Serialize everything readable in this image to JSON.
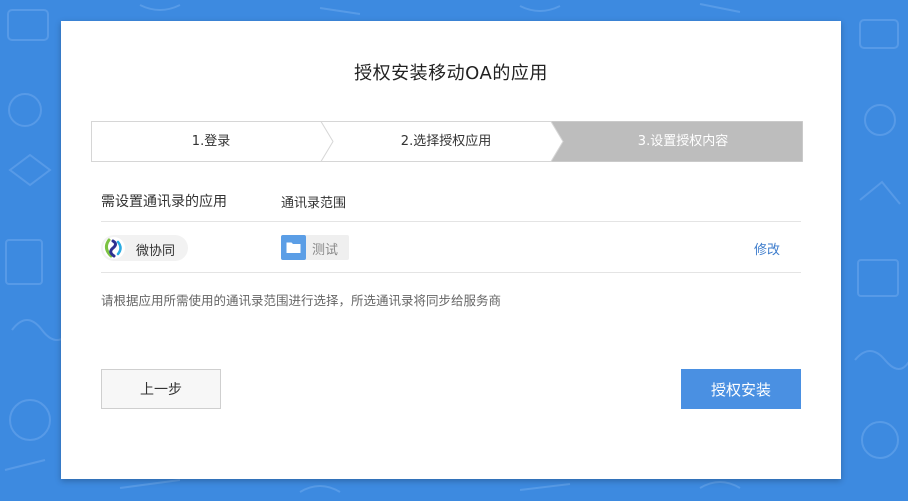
{
  "dialog": {
    "title": "授权安装移动OA的应用",
    "steps": [
      {
        "label": "1.登录",
        "state": "done"
      },
      {
        "label": "2.选择授权应用",
        "state": "done"
      },
      {
        "label": "3.设置授权内容",
        "state": "active"
      }
    ],
    "table": {
      "header_app": "需设置通讯录的应用",
      "header_scope": "通讯录范围",
      "rows": [
        {
          "app_name": "微协同",
          "app_icon": "weixietong-logo-icon",
          "scope": "测试",
          "scope_icon": "folder-icon",
          "action": "修改"
        }
      ]
    },
    "hint": "请根据应用所需使用的通讯录范围进行选择，所选通讯录将同步给服务商",
    "buttons": {
      "prev": "上一步",
      "install": "授权安装"
    }
  },
  "colors": {
    "background": "#3d8ae0",
    "primary": "#4a90e2",
    "step_active": "#bdbdbd",
    "link": "#3d7ccc"
  }
}
